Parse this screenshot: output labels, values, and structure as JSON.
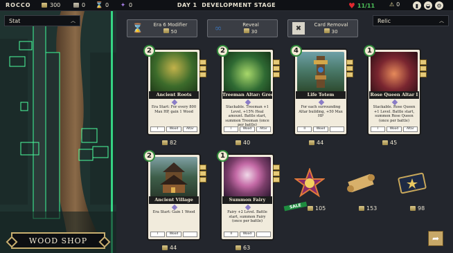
{
  "topbar": {
    "player": "ROCCO",
    "gold": "300",
    "resource2": "0",
    "hourglass": "0",
    "resource4": "0",
    "day": "DAY 1",
    "stage": "DEVELOPMENT STAGE",
    "health": "11/11",
    "alerts": "0"
  },
  "left": {
    "stat_select": "Stat",
    "shop_title": "WOOD SHOP"
  },
  "relic_select": "Relic",
  "actions": [
    {
      "label": "Era 6 Modifier",
      "cost": "50",
      "icon": "hourglass-icon"
    },
    {
      "label": "Reveal",
      "cost": "30",
      "icon": "binoculars-icon"
    },
    {
      "label": "Card Removal",
      "cost": "30",
      "icon": "trash-icon"
    }
  ],
  "cards": [
    {
      "level": "2",
      "name": "Ancient Roots",
      "desc": "Era Start: For every 800 Max HP, gain 1 Wood",
      "tags": [
        "I",
        "Wood",
        "Altar"
      ],
      "price": "82",
      "art": "#3c6b2b"
    },
    {
      "level": "2",
      "name": "Treeman Altar: Green",
      "desc": "Stackable. Treeman +1 Level, +15% Heal amount. Battle start, summon Treeman (once per battle)",
      "tags": [
        "I",
        "Wood",
        "Altar"
      ],
      "price": "40",
      "art": "#2f6a33"
    },
    {
      "level": "4",
      "name": "Life Totem",
      "desc": "For each surrounding Altar building, +50 Max HP",
      "tags": [
        "II",
        "Wood",
        ""
      ],
      "price": "44",
      "art": "#4a7a6a"
    },
    {
      "level": "1",
      "name": "Rose Queen Altar I",
      "desc": "Stackable. Rose Queen +1 Level. Battle start, summon Rose Queen (once per battle)",
      "tags": [
        "I",
        "Wood",
        "Altar"
      ],
      "price": "45",
      "art": "#7a2630"
    },
    {
      "level": "2",
      "name": "Ancient Village",
      "desc": "Era Start: Gain 1 Wood",
      "tags": [
        "I",
        "Wood",
        ""
      ],
      "price": "44",
      "art": "#3e5f4a"
    },
    {
      "level": "1",
      "name": "Summon Fairy",
      "desc": "Fairy +2 Level. Battle start, summon Fairy (once per battle)",
      "tags": [
        "II",
        "Wood",
        ""
      ],
      "price": "63",
      "art": "#7b3e6a"
    }
  ],
  "relics": [
    {
      "name": "star-amulet-icon",
      "price": "105",
      "sale": "SALE"
    },
    {
      "name": "scroll-icon",
      "price": "153"
    },
    {
      "name": "ticket-icon",
      "price": "98"
    }
  ]
}
